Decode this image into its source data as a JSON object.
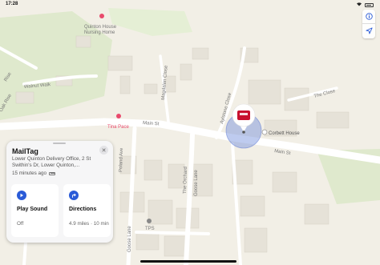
{
  "status_bar": {
    "time": "17:28",
    "battery": ""
  },
  "map": {
    "labels": {
      "nursing_home": "Quinton House\nNursing Home",
      "walnut_walk": "Walnut Walk",
      "tina_pace": "Tina Pace",
      "main_st_1": "Main St",
      "main_st_2": "Main St",
      "magdalen_close": "Magdalen Close",
      "aylstone_close": "Aylstone Close",
      "the_close": "The Close",
      "corbett_house": "Corbett House",
      "poland_ave": "Poland Ave",
      "the_orchard": "The Orchard",
      "goose_lane_1": "Goose Lane",
      "goose_lane_2": "Goose Lane",
      "tps": "TPS",
      "rise": "Rise",
      "oak_rise": "Oak Rise"
    },
    "accent": "#e94a6d",
    "road_color": "#ffffff",
    "park_color": "#d8e8c3",
    "building_color": "#e6e2d8"
  },
  "controls": {
    "info_icon": "info-icon",
    "location_icon": "location-arrow-icon"
  },
  "panel": {
    "title": "MailTag",
    "address": "Lower Quinton Delivery Office, 2 St Swithin's Dr, Lower Quinton,...",
    "time_ago": "15 minutes ago",
    "play_sound": {
      "label": "Play Sound",
      "sub": "Off"
    },
    "directions": {
      "label": "Directions",
      "sub": "4.9 miles · 10 min"
    },
    "accent": "#2a5bd7"
  }
}
